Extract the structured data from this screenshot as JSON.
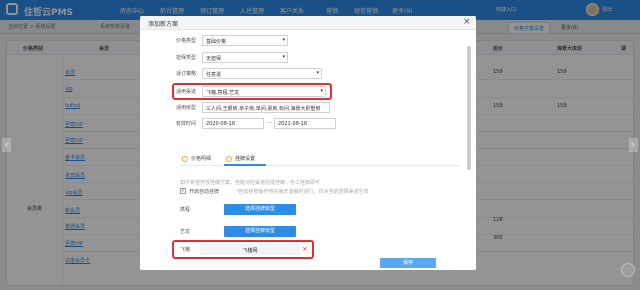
{
  "topbar": {
    "brand": "住哲云PMS",
    "nav": [
      "房态中心",
      "前台管理",
      "预订管理",
      "入住管理",
      "客户关系",
      "营销",
      "短信营销",
      "更多(9)"
    ],
    "message": "快捷入口",
    "user": "退出"
  },
  "tabstrip": {
    "crumbs": [
      "当前位置 > 系统设置",
      "系统参数设置"
    ],
    "tabs": [
      "价格方案设置",
      "更多(8)"
    ],
    "active_tab": "价格方案设置"
  },
  "bg_table": {
    "headers": [
      "价格类别",
      "会员",
      "房价",
      "海景大床房",
      "湖"
    ],
    "group_label": "会员类",
    "rows": [
      "会员",
      "vip",
      "fsdfsd",
      "至尊VIP",
      "至尊VIP",
      "金卡会员",
      "贵宾会员",
      "vip会员",
      "新会员",
      "普通会员",
      "至尊VIP",
      "白金会员卡"
    ],
    "numbers": [
      {
        "col": "房价",
        "value": "159"
      },
      {
        "col": "海景大床房",
        "value": "159"
      },
      {
        "col": "房价",
        "value": "159"
      },
      {
        "col": "海景大床房",
        "value": "159"
      },
      {
        "col": "房价",
        "value": "128"
      },
      {
        "col": "房价",
        "value": "300"
      }
    ]
  },
  "modal": {
    "title": "添加新方案",
    "close": "×",
    "fields": [
      {
        "label": "价格类型",
        "value": "基础价格"
      },
      {
        "label": "担保类型",
        "value": "无担保"
      },
      {
        "label": "适订策略",
        "value": "任意退"
      },
      {
        "label": "适用渠道",
        "value": "飞猪,携程,艺龙"
      },
      {
        "label": "适用房型",
        "value": "三人间,王爵房,亲子房,单间,豪房,标间,海景大别墅房"
      },
      {
        "label": "有效时间",
        "from": "2020-08-18",
        "to": "2021-08-18"
      }
    ],
    "date_sep": "—",
    "subtabs": [
      "价格明细",
      "挂牌设置"
    ],
    "active_subtab": "挂牌设置",
    "hint": "如不希望开放挂牌方案，也能对应渠道完成挂牌，手工挂牌即可",
    "auto_check_label": "开启自动挂牌",
    "auto_check_hint": "*自动挂牌操作将在每天凌晨时进行，仅对当前选择渠道生效",
    "channels": [
      {
        "name": "携程",
        "button": "选择挂牌房型"
      },
      {
        "name": "艺龙",
        "button": "选择挂牌房型"
      },
      {
        "name": "飞猪",
        "value": "飞猪网",
        "remove": "×"
      }
    ],
    "save": "保存"
  },
  "colors": {
    "primary": "#2e8be6",
    "highlight_red": "#e03131",
    "overlay": "rgba(0,0,0,0.42)"
  },
  "icons": [
    "logo-icon",
    "close-icon",
    "caret-down-icon",
    "calendar-icon",
    "remove-icon",
    "help-icon",
    "arrow-left-icon",
    "arrow-right-icon"
  ]
}
